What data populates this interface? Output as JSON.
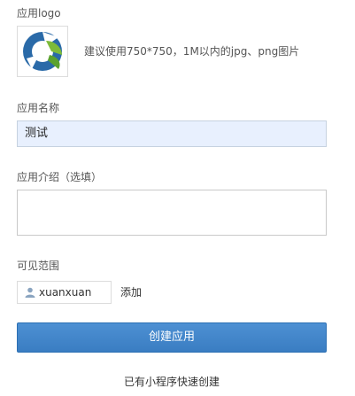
{
  "logo_section": {
    "label": "应用logo",
    "hint": "建议使用750*750，1M以内的jpg、png图片",
    "logo_icon": "app-logo-image"
  },
  "name_section": {
    "label": "应用名称",
    "value": "测试"
  },
  "intro_section": {
    "label": "应用介绍（选填）",
    "value": ""
  },
  "visibility_section": {
    "label": "可见范围",
    "user_icon": "person-icon",
    "user_name": "xuanxuan",
    "add_label": "添加"
  },
  "actions": {
    "create_label": "创建应用",
    "quick_create_label": "已有小程序快速创建"
  },
  "colors": {
    "button_bg": "#3a7dc2",
    "name_input_bg": "#e8f0fe",
    "logo_blue": "#2a6aa8",
    "logo_green": "#7dbb3a"
  }
}
